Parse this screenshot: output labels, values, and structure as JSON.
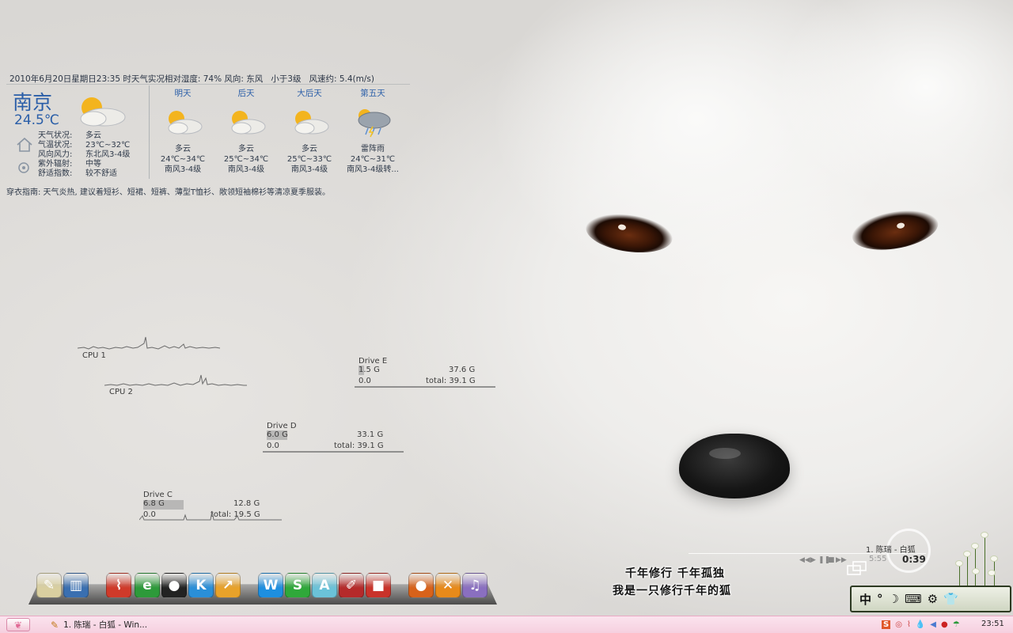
{
  "weather": {
    "headline": [
      "2010年6月20日星期日23:35 时天气实况相对湿度: 74% 风向: 东风",
      "小于3级",
      "风速约: 5.4(m/s)"
    ],
    "city": "南京",
    "current_temp": "24.5℃",
    "details": [
      {
        "k": "天气状况:",
        "v": "多云"
      },
      {
        "k": "气温状况:",
        "v": "23℃~32℃"
      },
      {
        "k": "风向风力:",
        "v": "东北风3-4级"
      },
      {
        "k": "紫外辐射:",
        "v": "中等"
      },
      {
        "k": "舒适指数:",
        "v": "较不舒适"
      }
    ],
    "forecast": [
      {
        "day": "明天",
        "cond": "多云",
        "temp": "24℃~34℃",
        "wind": "南风3-4级",
        "icon": "partly-cloudy-icon"
      },
      {
        "day": "后天",
        "cond": "多云",
        "temp": "25℃~34℃",
        "wind": "南风3-4级",
        "icon": "partly-cloudy-icon"
      },
      {
        "day": "大后天",
        "cond": "多云",
        "temp": "25℃~33℃",
        "wind": "南风3-4级",
        "icon": "partly-cloudy-icon"
      },
      {
        "day": "第五天",
        "cond": "雷阵雨",
        "temp": "24℃~31℃",
        "wind": "南风3-4级转...",
        "icon": "thunderstorm-icon"
      }
    ],
    "advice": "穿衣指南: 天气炎热, 建议着短衫、短裙、短裤、薄型T恤衫、敞领短袖棉衫等清凉夏季服装。"
  },
  "cpu": [
    {
      "label": "CPU 1"
    },
    {
      "label": "CPU 2"
    }
  ],
  "drives": [
    {
      "name": "Drive E",
      "used": "1.5 G",
      "free": "37.6 G",
      "zero": "0.0",
      "total": "total: 39.1 G",
      "used_fraction": 0.04
    },
    {
      "name": "Drive D",
      "used": "6.0 G",
      "free": "33.1 G",
      "zero": "0.0",
      "total": "total: 39.1 G",
      "used_fraction": 0.15
    },
    {
      "name": "Drive C",
      "used": "6.8 G",
      "free": "12.8 G",
      "zero": "0.0",
      "total": "total: 19.5 G",
      "used_fraction": 0.35
    }
  ],
  "dock": [
    {
      "name": "notepad-icon",
      "glyph": "✎",
      "color": "#d9cfa0"
    },
    {
      "name": "books-icon",
      "glyph": "▥",
      "color": "#3a6fb0"
    },
    {
      "name": "network-icon",
      "glyph": "⌇",
      "color": "#d03a2a"
    },
    {
      "name": "ie-browser-icon",
      "glyph": "e",
      "color": "#2d9a3a"
    },
    {
      "name": "qq-icon",
      "glyph": "●",
      "color": "#222222"
    },
    {
      "name": "kugou-icon",
      "glyph": "K",
      "color": "#2a8fd8"
    },
    {
      "name": "share-icon",
      "glyph": "↗",
      "color": "#e8a22a"
    },
    {
      "name": "wps-writer-icon",
      "glyph": "W",
      "color": "#1e8fe0"
    },
    {
      "name": "wps-spreadsheet-icon",
      "glyph": "S",
      "color": "#2fa83a"
    },
    {
      "name": "font-tool-icon",
      "glyph": "A",
      "color": "#6bc2d8"
    },
    {
      "name": "draw-icon",
      "glyph": "✐",
      "color": "#b52a2a"
    },
    {
      "name": "package-icon",
      "glyph": "■",
      "color": "#c9332a"
    },
    {
      "name": "media-ball-icon",
      "glyph": "●",
      "color": "#d8621a"
    },
    {
      "name": "tools-icon",
      "glyph": "✕",
      "color": "#e88a1a"
    },
    {
      "name": "music-note-icon",
      "glyph": "♫",
      "color": "#8a6fc0"
    }
  ],
  "lyrics": {
    "line1": "千年修行 千年孤独",
    "line2": "我是一只修行千年的狐"
  },
  "player": {
    "title": "1. 陈瑞 - 白狐",
    "elapsed": "5:55",
    "time": "0:39"
  },
  "ime": {
    "items": [
      "中",
      "°",
      "☽",
      "⌨",
      "⚙",
      "👕"
    ]
  },
  "taskbar": {
    "task_label": "1. 陈瑞 - 白狐 - Win...",
    "clock": "23:51"
  },
  "colors": {
    "taskbar": "#f6d0df",
    "accent_blue": "#2a5ea8"
  }
}
